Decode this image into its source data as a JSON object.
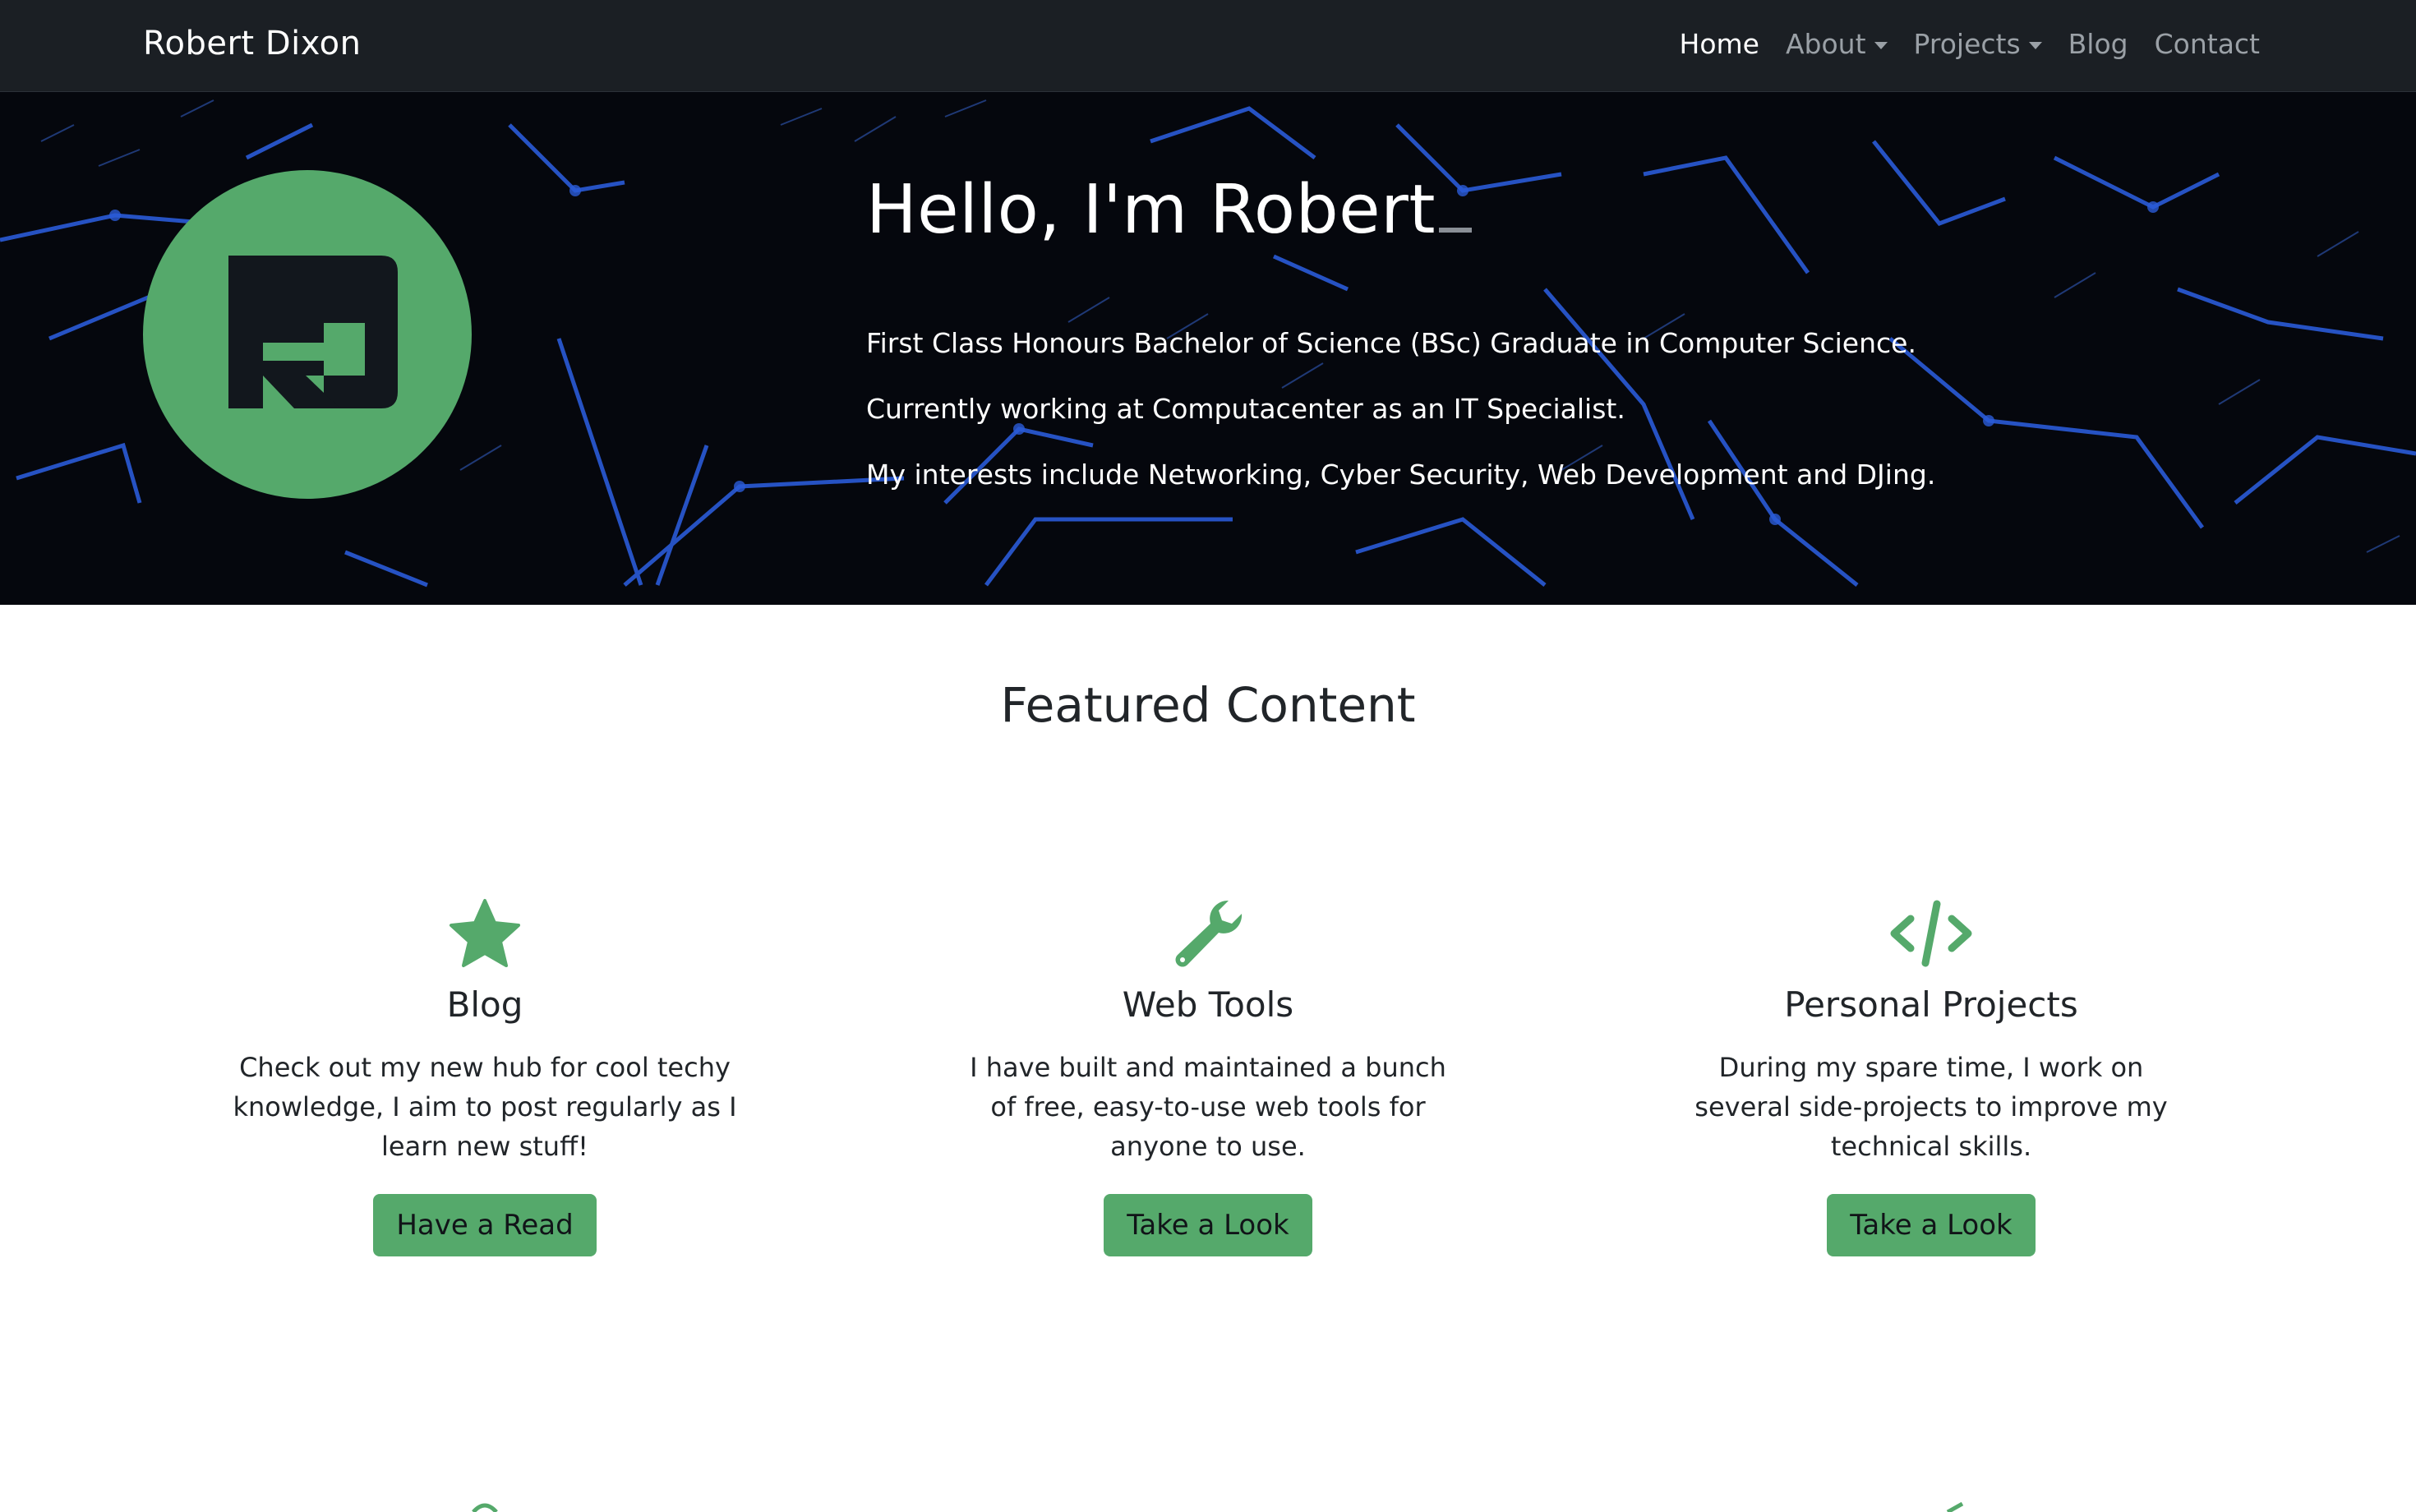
{
  "navbar": {
    "brand": "Robert Dixon",
    "items": [
      {
        "label": "Home",
        "active": true,
        "dropdown": false
      },
      {
        "label": "About",
        "active": false,
        "dropdown": true
      },
      {
        "label": "Projects",
        "active": false,
        "dropdown": true
      },
      {
        "label": "Blog",
        "active": false,
        "dropdown": false
      },
      {
        "label": "Contact",
        "active": false,
        "dropdown": false
      }
    ]
  },
  "hero": {
    "logo_icon": "rd-monogram-logo",
    "title": "Hello, I'm Robert",
    "lines": [
      "First Class Honours Bachelor of Science (BSc) Graduate in Computer Science.",
      "Currently working at Computacenter as an IT Specialist.",
      "My interests include Networking, Cyber Security, Web Development and DJing."
    ]
  },
  "featured": {
    "title": "Featured Content",
    "cards": [
      {
        "icon": "star-icon",
        "title": "Blog",
        "text": "Check out my new hub for cool techy knowledge, I aim to post regularly as I learn new stuff!",
        "button": "Have a Read"
      },
      {
        "icon": "wrench-icon",
        "title": "Web Tools",
        "text": "I have built and maintained a bunch of free, easy-to-use web tools for anyone to use.",
        "button": "Take a Look"
      },
      {
        "icon": "code-icon",
        "title": "Personal Projects",
        "text": "During my spare time, I work on several side-projects to improve my technical skills.",
        "button": "Take a Look"
      }
    ]
  },
  "colors": {
    "accent": "#55a96b",
    "navbar_bg": "#1b1f24",
    "hero_bg": "#05070d",
    "circuit": "#2a5bd7"
  }
}
